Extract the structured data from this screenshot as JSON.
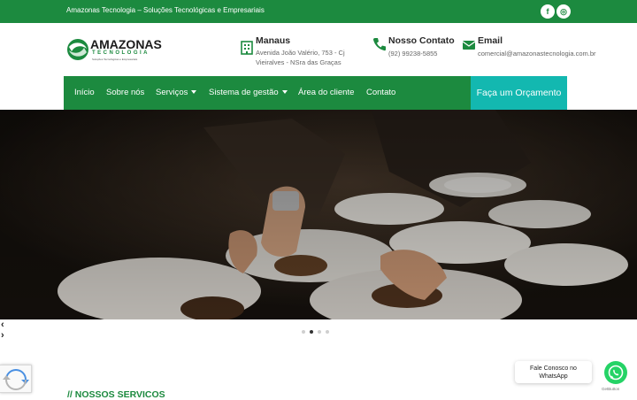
{
  "topbar": {
    "tagline": "Amazonas Tecnologia – Soluções Tecnológicas e Empresariais",
    "social": [
      {
        "icon": "facebook-icon",
        "glyph": "f"
      },
      {
        "icon": "instagram-icon",
        "glyph": "◎"
      }
    ]
  },
  "logo": {
    "brand": "AMAZONAS",
    "brand_sub": "TECNOLOGIA",
    "brand_tagline": "Soluções Tecnológicas e Empresariais"
  },
  "contact": {
    "address_title": "Manaus",
    "address_line1": "Avenida João Valério, 753 - Cj",
    "address_line2": "Vieiralves - NSra das Graças",
    "phone_title": "Nosso Contato",
    "phone": "(92) 99238-5855",
    "email_title": "Email",
    "email": "comercial@amazonastecnologia.com.br"
  },
  "nav": {
    "items": [
      "Início",
      "Sobre nós",
      "Serviços",
      "Sistema de gestão",
      "Área do cliente",
      "Contato"
    ],
    "cta": "Faça um Orçamento"
  },
  "slider": {
    "prev": "‹",
    "next": "›",
    "active_dot": 2,
    "dot_count": 4
  },
  "section": {
    "title": "// NOSSOS SERVICOS"
  },
  "whatsapp": {
    "bubble_line1": "Fale Conosco no",
    "bubble_line2": "WhatsApp",
    "credit": "GetButton"
  },
  "colors": {
    "brand_green": "#1c8a3f",
    "teal": "#13b8b0",
    "whatsapp": "#25d366"
  }
}
